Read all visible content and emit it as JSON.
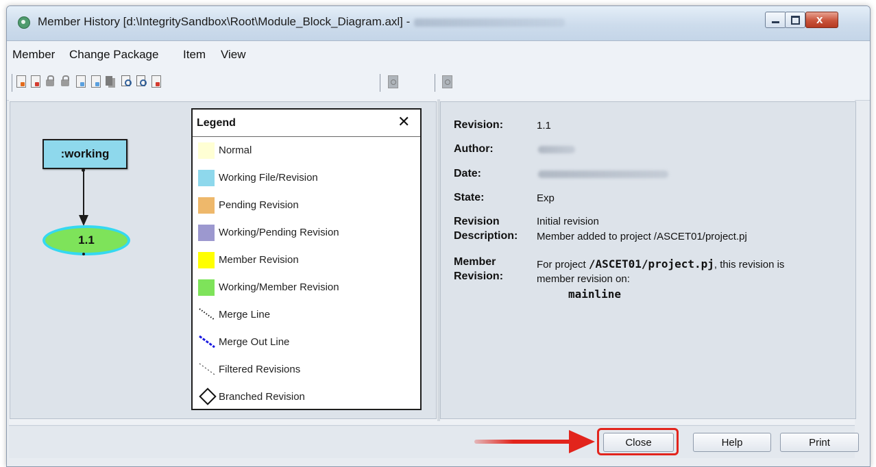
{
  "window": {
    "title": "Member History [d:\\IntegritySandbox\\Root\\Module_Block_Diagram.axl] -"
  },
  "menu": {
    "items": [
      "Member",
      "Change Package",
      "Item",
      "View"
    ]
  },
  "toolbar": {
    "icons": [
      "open-file-icon",
      "edit-file-icon",
      "lock-icon",
      "unlock-icon",
      "view-file-icon",
      "compare-file-icon",
      "copy-revisions-icon",
      "find-revision-icon",
      "search-revision-icon",
      "report-icon",
      "details-icon",
      "locate-icon"
    ]
  },
  "graph": {
    "working_label": ":working",
    "revision_label": "1.1"
  },
  "legend": {
    "title": "Legend",
    "close": "✕",
    "items": [
      {
        "label": "Normal",
        "color": "#ffffd4"
      },
      {
        "label": "Working File/Revision",
        "color": "#8ed8ec"
      },
      {
        "label": "Pending Revision",
        "color": "#eeb86b"
      },
      {
        "label": "Working/Pending Revision",
        "color": "#9c98cf"
      },
      {
        "label": "Member Revision",
        "color": "#ffff00"
      },
      {
        "label": "Working/Member Revision",
        "color": "#7ee35a"
      },
      {
        "label": "Merge Line"
      },
      {
        "label": "Merge Out Line"
      },
      {
        "label": "Filtered Revisions"
      },
      {
        "label": "Branched Revision"
      }
    ]
  },
  "details": {
    "revision_label": "Revision:",
    "revision_value": "1.1",
    "author_label": "Author:",
    "date_label": "Date:",
    "state_label": "State:",
    "state_value": "Exp",
    "description_label_1": "Revision",
    "description_label_2": "Description:",
    "description_value_1": "Initial revision",
    "description_value_2": "Member added to project /ASCET01/project.pj",
    "member_label_1": "Member",
    "member_label_2": "Revision:",
    "member_value_prefix": "For project ",
    "member_value_project": "/ASCET01/project.pj",
    "member_value_suffix": ", this revision is",
    "member_value_2": "member revision on:",
    "member_value_3": "mainline"
  },
  "buttons": {
    "close": "Close",
    "help": "Help",
    "print": "Print"
  },
  "colors": {
    "annotation_red": "#e2241c",
    "working_box": "#8ed8ec",
    "revision_node": "#7ee35a",
    "revision_border": "#35d8f0"
  }
}
